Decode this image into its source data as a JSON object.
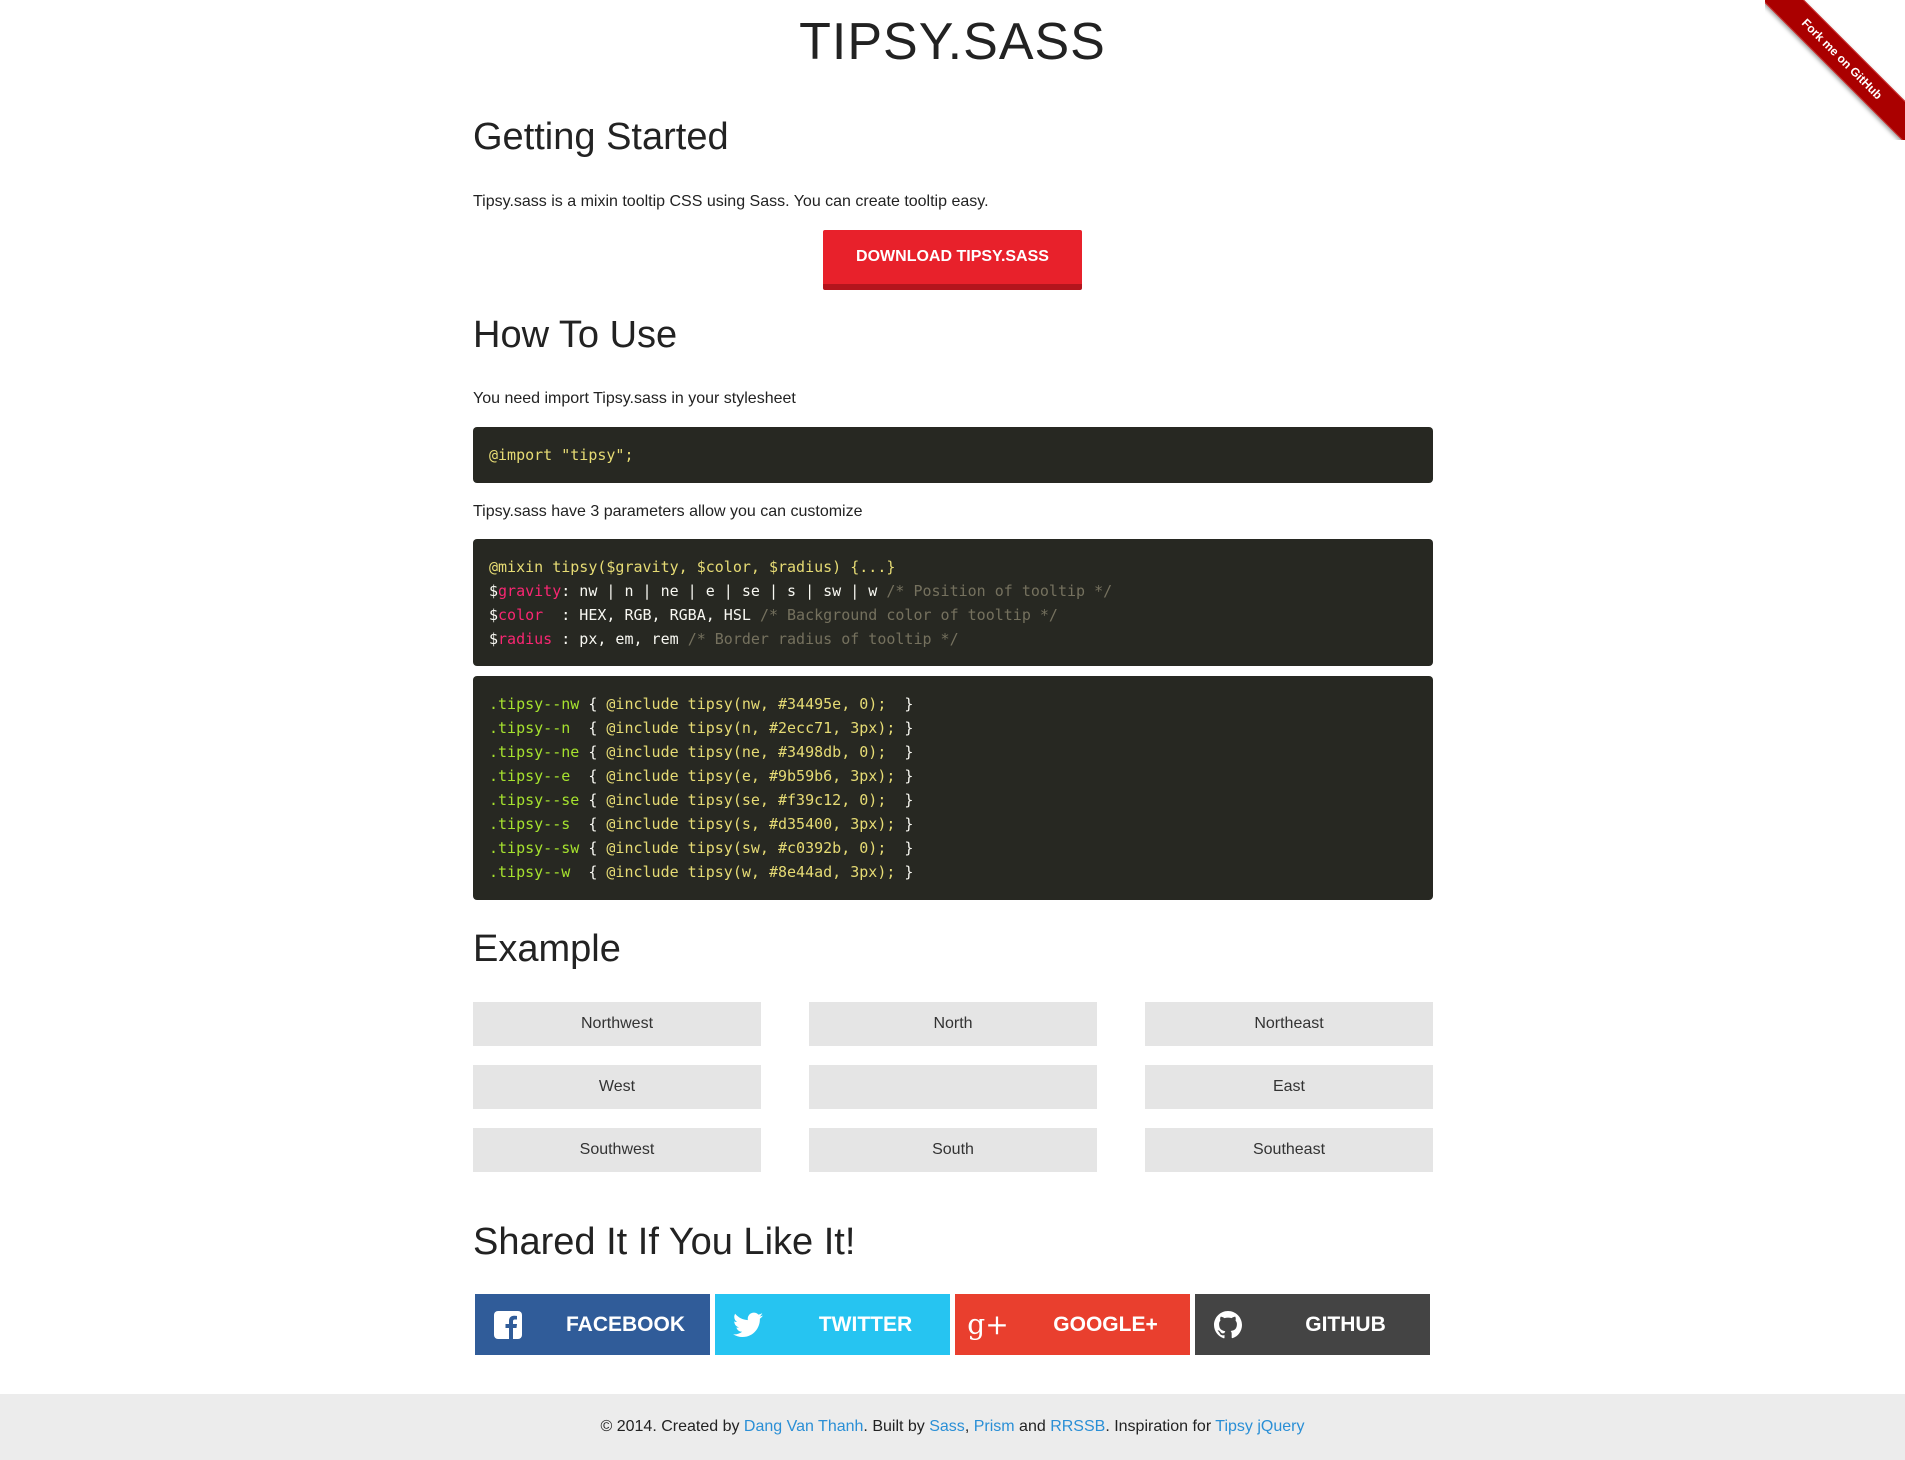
{
  "ribbon": {
    "label": "Fork me on GitHub"
  },
  "title": "TIPSY.SASS",
  "getting_started": {
    "heading": "Getting Started",
    "intro": "Tipsy.sass is a mixin tooltip CSS using Sass. You can create tooltip easy.",
    "download_label": "DOWNLOAD TIPSY.SASS"
  },
  "how_to_use": {
    "heading": "How To Use",
    "import_text": "You need import Tipsy.sass in your stylesheet",
    "import_code": {
      "at": "@import",
      "str": " \"tipsy\";"
    },
    "params_text": "Tipsy.sass have 3 parameters allow you can customize",
    "mixin_code": {
      "line1": "@mixin tipsy($gravity, $color, $radius) {...}",
      "gravity": {
        "dollar": "$",
        "name": "gravity",
        "value": ": nw | n | ne | e | se | s | sw | w ",
        "comment": "/* Position of tooltip */"
      },
      "color": {
        "dollar": "$",
        "name": "color",
        "value": "  : HEX, RGB, RGBA, HSL ",
        "comment": "/* Background color of tooltip */"
      },
      "radius": {
        "dollar": "$",
        "name": "radius",
        "value": " : px, em, rem ",
        "comment": "/* Border radius of tooltip */"
      }
    },
    "class_lines": [
      {
        "sel": ".tipsy--nw",
        "open": " { ",
        "inc": "@include tipsy(nw, #34495e, 0);",
        "close": "  }"
      },
      {
        "sel": ".tipsy--n ",
        "open": " { ",
        "inc": "@include tipsy(n, #2ecc71, 3px);",
        "close": " }"
      },
      {
        "sel": ".tipsy--ne",
        "open": " { ",
        "inc": "@include tipsy(ne, #3498db, 0);",
        "close": "  }"
      },
      {
        "sel": ".tipsy--e ",
        "open": " { ",
        "inc": "@include tipsy(e, #9b59b6, 3px);",
        "close": " }"
      },
      {
        "sel": ".tipsy--se",
        "open": " { ",
        "inc": "@include tipsy(se, #f39c12, 0);",
        "close": "  }"
      },
      {
        "sel": ".tipsy--s ",
        "open": " { ",
        "inc": "@include tipsy(s, #d35400, 3px);",
        "close": " }"
      },
      {
        "sel": ".tipsy--sw",
        "open": " { ",
        "inc": "@include tipsy(sw, #c0392b, 0);",
        "close": "  }"
      },
      {
        "sel": ".tipsy--w ",
        "open": " { ",
        "inc": "@include tipsy(w, #8e44ad, 3px);",
        "close": " }"
      }
    ]
  },
  "example": {
    "heading": "Example",
    "buttons": {
      "northwest": "Northwest",
      "north": "North",
      "northeast": "Northeast",
      "west": "West",
      "center": "",
      "east": "East",
      "southwest": "Southwest",
      "south": "South",
      "southeast": "Southeast"
    }
  },
  "share": {
    "heading": "Shared It If You Like It!",
    "facebook": {
      "label": "FACEBOOK",
      "color": "#305c99",
      "icon": "facebook-icon"
    },
    "twitter": {
      "label": "TWITTER",
      "color": "#26c4f1",
      "icon": "twitter-icon"
    },
    "googleplus": {
      "label": "GOOGLE+",
      "color": "#e93f2e",
      "icon": "google-plus-icon"
    },
    "github": {
      "label": "GITHUB",
      "color": "#444444",
      "icon": "github-icon"
    }
  },
  "footer": {
    "prefix": "© 2014. Created by ",
    "author": "Dang Van Thanh",
    "built_by": ". Built by ",
    "sass": "Sass",
    "comma": ", ",
    "prism": "Prism",
    "and": " and ",
    "rrssb": "RRSSB",
    "inspiration": ". Inspiration for ",
    "tipsy": "Tipsy jQuery"
  }
}
